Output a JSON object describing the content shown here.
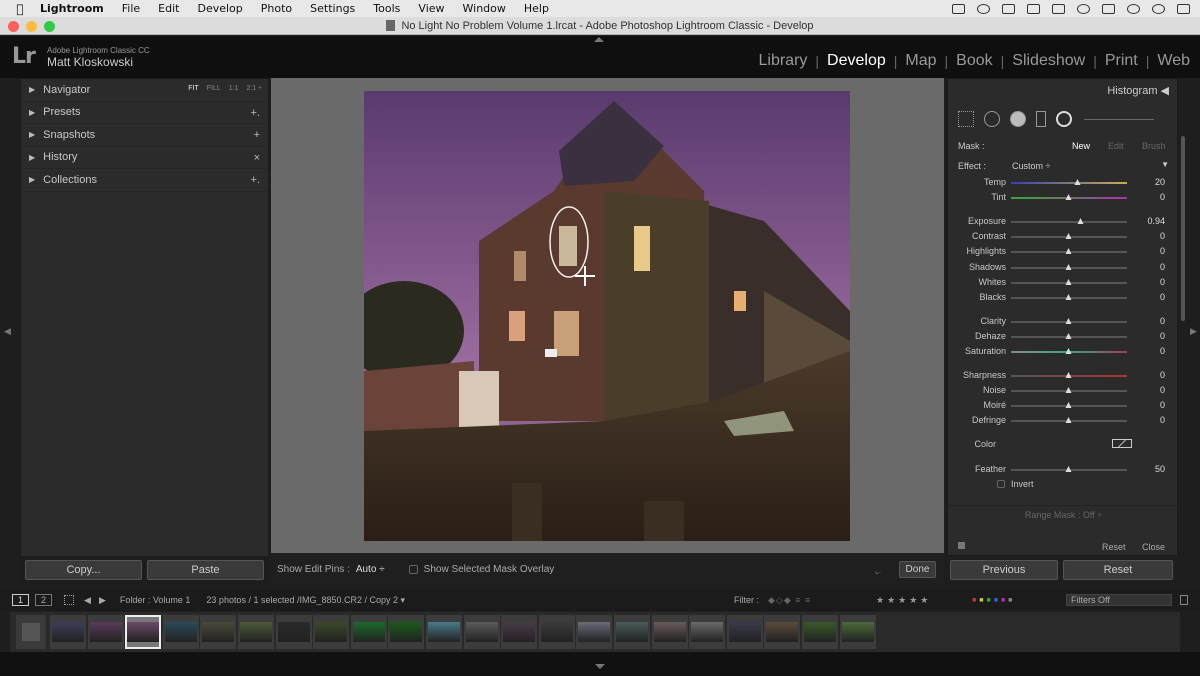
{
  "menubar": {
    "app": "Lightroom",
    "items": [
      "File",
      "Edit",
      "Develop",
      "Photo",
      "Settings",
      "Tools",
      "View",
      "Window",
      "Help"
    ]
  },
  "window": {
    "title": "No Light No Problem Volume 1.lrcat - Adobe Photoshop Lightroom Classic - Develop"
  },
  "identity": {
    "product": "Adobe Lightroom Classic CC",
    "user": "Matt Kloskowski"
  },
  "modules": [
    "Library",
    "Develop",
    "Map",
    "Book",
    "Slideshow",
    "Print",
    "Web"
  ],
  "active_module": "Develop",
  "left_panel": {
    "navigator": {
      "label": "Navigator",
      "zooms": [
        "FIT",
        "FILL",
        "1:1",
        "2:1 ÷"
      ]
    },
    "sections": [
      {
        "label": "Presets",
        "action": "+."
      },
      {
        "label": "Snapshots",
        "action": "+"
      },
      {
        "label": "History",
        "action": "×"
      },
      {
        "label": "Collections",
        "action": "+."
      }
    ],
    "copy_label": "Copy...",
    "paste_label": "Paste"
  },
  "toolbar": {
    "edit_pins_label": "Show Edit Pins :",
    "edit_pins_value": "Auto ÷",
    "mask_overlay_label": "Show Selected Mask Overlay",
    "done_label": "Done"
  },
  "right_panel": {
    "histogram_label": "Histogram ◀",
    "mask": {
      "label": "Mask :",
      "new": "New",
      "edit": "Edit",
      "brush": "Brush"
    },
    "effect": {
      "label": "Effect :",
      "value": "Custom ÷"
    },
    "sliders": [
      {
        "label": "Temp",
        "value": "20",
        "pos": 0.58,
        "track": "temp"
      },
      {
        "label": "Tint",
        "value": "0",
        "pos": 0.5,
        "track": "tint"
      },
      {
        "label": "Exposure",
        "value": "0.94",
        "pos": 0.6,
        "track": "gray"
      },
      {
        "label": "Contrast",
        "value": "0",
        "pos": 0.5,
        "track": "gray"
      },
      {
        "label": "Highlights",
        "value": "0",
        "pos": 0.5,
        "track": "gray"
      },
      {
        "label": "Shadows",
        "value": "0",
        "pos": 0.5,
        "track": "gray"
      },
      {
        "label": "Whites",
        "value": "0",
        "pos": 0.5,
        "track": "gray"
      },
      {
        "label": "Blacks",
        "value": "0",
        "pos": 0.5,
        "track": "gray"
      },
      {
        "label": "Clarity",
        "value": "0",
        "pos": 0.5,
        "track": "gray"
      },
      {
        "label": "Dehaze",
        "value": "0",
        "pos": 0.5,
        "track": "gray"
      },
      {
        "label": "Saturation",
        "value": "0",
        "pos": 0.5,
        "track": "sat"
      },
      {
        "label": "Sharpness",
        "value": "0",
        "pos": 0.5,
        "track": "sharp"
      },
      {
        "label": "Noise",
        "value": "0",
        "pos": 0.5,
        "track": "gray"
      },
      {
        "label": "Moiré",
        "value": "0",
        "pos": 0.5,
        "track": "gray"
      },
      {
        "label": "Defringe",
        "value": "0",
        "pos": 0.5,
        "track": "gray"
      }
    ],
    "color_label": "Color",
    "feather": {
      "label": "Feather",
      "value": "50",
      "pos": 0.5
    },
    "invert_label": "Invert",
    "range_mask": "Range Mask : Off ÷",
    "reset_label": "Reset",
    "close_label": "Close",
    "previous_button": "Previous",
    "reset_button": "Reset"
  },
  "filmstrip": {
    "view1": "1",
    "view2": "2",
    "source": "Folder : Volume 1",
    "info": "23 photos / 1 selected /IMG_8850.CR2 / Copy 2 ▾",
    "filter_label": "Filter :",
    "filters_off": "Filters Off",
    "thumb_colors": [
      "#3d3d5a",
      "#5a3a5a",
      "#6a4a6a",
      "#2a4a5a",
      "#4a4a3a",
      "#4a5a3a",
      "#2a2a2a",
      "#3a4a2a",
      "#1a6a2a",
      "#1a5a1a",
      "#4a7a8a",
      "#5a5a5a",
      "#4a3a4a",
      "#3a3a3a",
      "#6a6a7a",
      "#4a5a5a",
      "#6a5a5a",
      "#6a6a6a",
      "#3a3a4a",
      "#5a4a3a",
      "#3a5a2a",
      "#4a6a3a"
    ]
  },
  "colors": {
    "active_module": "#ffffff",
    "accent_tint_green": "#7a3",
    "accent_tint_purple": "#a3a"
  }
}
